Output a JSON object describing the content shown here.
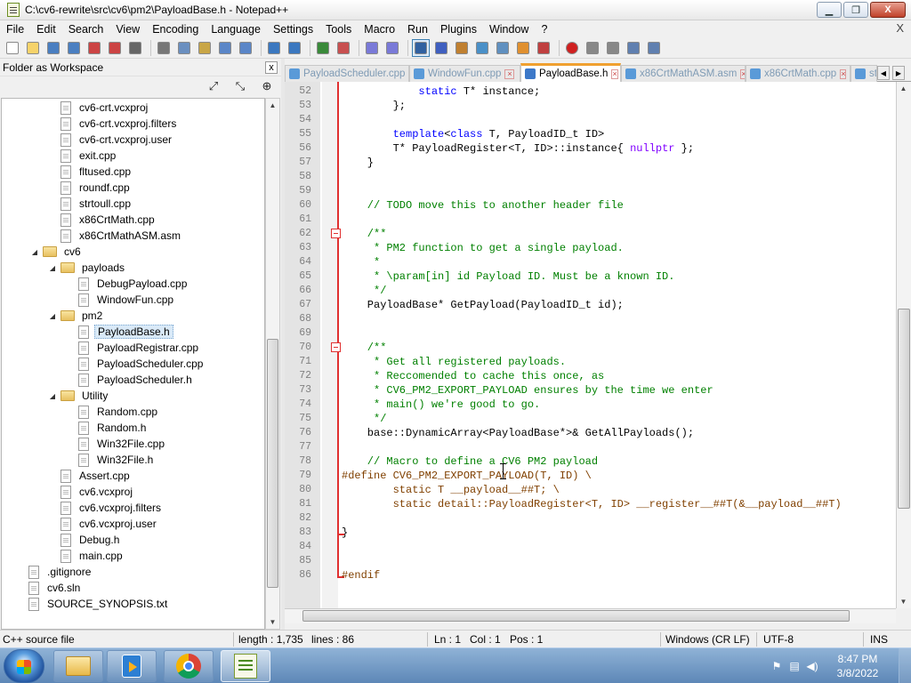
{
  "window": {
    "title": "C:\\cv6-rewrite\\src\\cv6\\pm2\\PayloadBase.h - Notepad++",
    "minimize_label": "▁",
    "restore_label": "❐",
    "close_label": "X"
  },
  "menu": {
    "items": [
      "File",
      "Edit",
      "Search",
      "View",
      "Encoding",
      "Language",
      "Settings",
      "Tools",
      "Macro",
      "Run",
      "Plugins",
      "Window",
      "?"
    ],
    "close_label": "X"
  },
  "toolbar": {
    "icons": [
      "new-file-icon",
      "open-file-icon",
      "save-icon",
      "save-all-icon",
      "close-icon",
      "close-all-icon",
      "print-icon",
      "cut-icon",
      "copy-icon",
      "paste-icon",
      "undo-icon",
      "redo-icon",
      "find-icon",
      "replace-icon",
      "zoom-in-icon",
      "zoom-out-icon",
      "sync-vertical-icon",
      "sync-horizontal-icon",
      "word-wrap-icon",
      "show-all-chars-icon",
      "indent-guide-icon",
      "document-map-icon",
      "function-list-icon",
      "folder-workspace-icon",
      "monitoring-icon",
      "record-macro-icon",
      "stop-record-icon",
      "play-macro-icon",
      "run-macro-multiple-icon",
      "save-macro-icon"
    ]
  },
  "panel": {
    "title": "Folder as Workspace",
    "close_label": "x",
    "tools": [
      "expand-all-icon",
      "collapse-all-icon",
      "locate-current-file-icon"
    ],
    "tree": [
      {
        "label": "cv6-crt.vcxproj",
        "type": "file",
        "depth": 3
      },
      {
        "label": "cv6-crt.vcxproj.filters",
        "type": "file",
        "depth": 3
      },
      {
        "label": "cv6-crt.vcxproj.user",
        "type": "file",
        "depth": 3
      },
      {
        "label": "exit.cpp",
        "type": "file",
        "depth": 3
      },
      {
        "label": "fltused.cpp",
        "type": "file",
        "depth": 3
      },
      {
        "label": "roundf.cpp",
        "type": "file",
        "depth": 3
      },
      {
        "label": "strtoull.cpp",
        "type": "file",
        "depth": 3
      },
      {
        "label": "x86CrtMath.cpp",
        "type": "file",
        "depth": 3
      },
      {
        "label": "x86CrtMathASM.asm",
        "type": "file",
        "depth": 3
      },
      {
        "label": "cv6",
        "type": "folder",
        "depth": 2
      },
      {
        "label": "payloads",
        "type": "folder",
        "depth": 3
      },
      {
        "label": "DebugPayload.cpp",
        "type": "file",
        "depth": 4
      },
      {
        "label": "WindowFun.cpp",
        "type": "file",
        "depth": 4
      },
      {
        "label": "pm2",
        "type": "folder",
        "depth": 3
      },
      {
        "label": "PayloadBase.h",
        "type": "file",
        "depth": 4,
        "selected": true
      },
      {
        "label": "PayloadRegistrar.cpp",
        "type": "file",
        "depth": 4
      },
      {
        "label": "PayloadScheduler.cpp",
        "type": "file",
        "depth": 4
      },
      {
        "label": "PayloadScheduler.h",
        "type": "file",
        "depth": 4
      },
      {
        "label": "Utility",
        "type": "folder",
        "depth": 3
      },
      {
        "label": "Random.cpp",
        "type": "file",
        "depth": 4
      },
      {
        "label": "Random.h",
        "type": "file",
        "depth": 4
      },
      {
        "label": "Win32File.cpp",
        "type": "file",
        "depth": 4
      },
      {
        "label": "Win32File.h",
        "type": "file",
        "depth": 4
      },
      {
        "label": "Assert.cpp",
        "type": "file",
        "depth": 3
      },
      {
        "label": "cv6.vcxproj",
        "type": "file",
        "depth": 3
      },
      {
        "label": "cv6.vcxproj.filters",
        "type": "file",
        "depth": 3
      },
      {
        "label": "cv6.vcxproj.user",
        "type": "file",
        "depth": 3
      },
      {
        "label": "Debug.h",
        "type": "file",
        "depth": 3
      },
      {
        "label": "main.cpp",
        "type": "file",
        "depth": 3
      },
      {
        "label": ".gitignore",
        "type": "file",
        "depth": 1
      },
      {
        "label": "cv6.sln",
        "type": "file",
        "depth": 1
      },
      {
        "label": "SOURCE_SYNOPSIS.txt",
        "type": "file",
        "depth": 1
      }
    ]
  },
  "tabs": [
    {
      "label": "PayloadScheduler.cpp"
    },
    {
      "label": "WindowFun.cpp"
    },
    {
      "label": "PayloadBase.h",
      "active": true
    },
    {
      "label": "x86CrtMathASM.asm"
    },
    {
      "label": "x86CrtMath.cpp"
    },
    {
      "label": "strto"
    }
  ],
  "editor": {
    "lines": [
      {
        "n": "52",
        "parts": [
          [
            "tx",
            "            "
          ],
          [
            "kw",
            "static"
          ],
          [
            "tx",
            " T* instance;"
          ]
        ]
      },
      {
        "n": "53",
        "parts": [
          [
            "tx",
            "        };"
          ]
        ]
      },
      {
        "n": "54",
        "parts": []
      },
      {
        "n": "55",
        "parts": [
          [
            "tx",
            "        "
          ],
          [
            "kw",
            "template"
          ],
          [
            "tx",
            "<"
          ],
          [
            "kw",
            "class"
          ],
          [
            "tx",
            " T, PayloadID_t ID>"
          ]
        ]
      },
      {
        "n": "56",
        "parts": [
          [
            "tx",
            "        T* PayloadRegister<T, ID>::instance{ "
          ],
          [
            "kw2",
            "nullptr"
          ],
          [
            "tx",
            " };"
          ]
        ]
      },
      {
        "n": "57",
        "parts": [
          [
            "tx",
            "    }"
          ]
        ]
      },
      {
        "n": "58",
        "parts": []
      },
      {
        "n": "59",
        "parts": []
      },
      {
        "n": "60",
        "parts": [
          [
            "cm",
            "    // TODO move this to another header file"
          ]
        ]
      },
      {
        "n": "61",
        "parts": []
      },
      {
        "n": "62",
        "parts": [
          [
            "cm",
            "    /**"
          ]
        ]
      },
      {
        "n": "63",
        "parts": [
          [
            "cm",
            "     * PM2 function to get a single payload."
          ]
        ]
      },
      {
        "n": "64",
        "parts": [
          [
            "cm",
            "     *"
          ]
        ]
      },
      {
        "n": "65",
        "parts": [
          [
            "cm",
            "     * \\param[in] id Payload ID. Must be a known ID."
          ]
        ]
      },
      {
        "n": "66",
        "parts": [
          [
            "cm",
            "     */"
          ]
        ]
      },
      {
        "n": "67",
        "parts": [
          [
            "tx",
            "    PayloadBase* GetPayload(PayloadID_t id);"
          ]
        ]
      },
      {
        "n": "68",
        "parts": []
      },
      {
        "n": "69",
        "parts": []
      },
      {
        "n": "70",
        "parts": [
          [
            "cm",
            "    /**"
          ]
        ]
      },
      {
        "n": "71",
        "parts": [
          [
            "cm",
            "     * Get all registered payloads."
          ]
        ]
      },
      {
        "n": "72",
        "parts": [
          [
            "cm",
            "     * Reccomended to cache this once, as"
          ]
        ]
      },
      {
        "n": "73",
        "parts": [
          [
            "cm",
            "     * CV6_PM2_EXPORT_PAYLOAD ensures by the time we enter"
          ]
        ]
      },
      {
        "n": "74",
        "parts": [
          [
            "cm",
            "     * main() we're good to go."
          ]
        ]
      },
      {
        "n": "75",
        "parts": [
          [
            "cm",
            "     */"
          ]
        ]
      },
      {
        "n": "76",
        "parts": [
          [
            "tx",
            "    base::DynamicArray<PayloadBase*>& GetAllPayloads();"
          ]
        ]
      },
      {
        "n": "77",
        "parts": []
      },
      {
        "n": "78",
        "parts": [
          [
            "cm",
            "    // Macro to define a CV6 PM2 payload"
          ]
        ]
      },
      {
        "n": "79",
        "parts": [
          [
            "pp",
            "#define CV6_PM2_EXPORT_PAYLOAD(T, ID) \\"
          ]
        ]
      },
      {
        "n": "80",
        "parts": [
          [
            "pp",
            "        static T __payload__##T; \\"
          ]
        ]
      },
      {
        "n": "81",
        "parts": [
          [
            "pp",
            "        static detail::PayloadRegister<T, ID> __register__##T(&__payload__##T)"
          ]
        ]
      },
      {
        "n": "82",
        "parts": []
      },
      {
        "n": "83",
        "parts": [
          [
            "tx",
            "}"
          ]
        ]
      },
      {
        "n": "84",
        "parts": []
      },
      {
        "n": "85",
        "parts": []
      },
      {
        "n": "86",
        "parts": [
          [
            "pp",
            "#endif"
          ]
        ]
      }
    ]
  },
  "status": {
    "file_type": "C++ source file",
    "length": "length : 1,735",
    "lines": "lines : 86",
    "ln": "Ln : 1",
    "col": "Col : 1",
    "pos": "Pos : 1",
    "eol": "Windows (CR LF)",
    "encoding": "UTF-8",
    "mode": "INS"
  },
  "taskbar": {
    "apps": [
      "explorer-icon",
      "media-player-icon",
      "chrome-icon",
      "notepad-plus-plus-icon"
    ],
    "time": "8:47 PM",
    "date": "3/8/2022"
  }
}
